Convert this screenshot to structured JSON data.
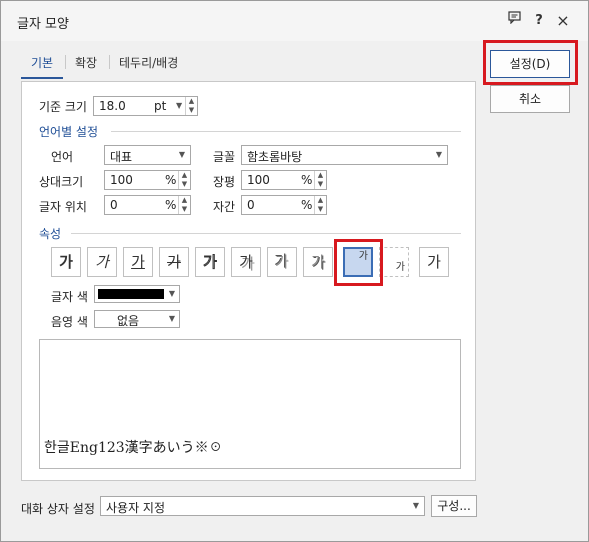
{
  "window": {
    "title": "글자 모양"
  },
  "titlebar": {
    "help_label": "?",
    "close_label": "×"
  },
  "tabs": [
    {
      "label": "기본"
    },
    {
      "label": "확장"
    },
    {
      "label": "테두리/배경"
    }
  ],
  "base_size": {
    "label": "기준 크기",
    "value": "18.0",
    "unit": "pt"
  },
  "language": {
    "section_title": "언어별 설정",
    "lang_label": "언어",
    "lang_value": "대표",
    "font_label": "글꼴",
    "font_value": "함초롬바탕",
    "rel_size_label": "상대크기",
    "rel_size_value": "100",
    "width_label": "장평",
    "width_value": "100",
    "position_label": "글자 위치",
    "position_value": "0",
    "spacing_label": "자간",
    "spacing_value": "0",
    "percent_unit": "%"
  },
  "attributes": {
    "section_title": "속성",
    "buttons": [
      {
        "name": "bold",
        "glyph": "가"
      },
      {
        "name": "italic",
        "glyph": "가"
      },
      {
        "name": "underline",
        "glyph": "가"
      },
      {
        "name": "strikethrough",
        "glyph": "가"
      },
      {
        "name": "outline",
        "glyph": "가"
      },
      {
        "name": "shadow",
        "glyph": "가"
      },
      {
        "name": "emboss",
        "glyph": "가"
      },
      {
        "name": "engrave",
        "glyph": "가"
      },
      {
        "name": "superscript",
        "glyph": "가"
      },
      {
        "name": "subscript",
        "glyph": "가"
      },
      {
        "name": "normal",
        "glyph": "가"
      }
    ]
  },
  "text_color": {
    "label": "글자 색"
  },
  "shade_color": {
    "label": "음영 색",
    "value": "없음"
  },
  "preview": {
    "text": "한글Eng123漢字あいう※☉"
  },
  "footer": {
    "dialog_setting_label": "대화 상자 설정",
    "dialog_setting_value": "사용자 지정",
    "config_label": "구성..."
  },
  "actions": {
    "ok_label": "설정(D)",
    "cancel_label": "취소"
  },
  "colors": {
    "accent": "#2b579a",
    "highlight": "#d7191f",
    "group_title": "#1f4e96"
  }
}
